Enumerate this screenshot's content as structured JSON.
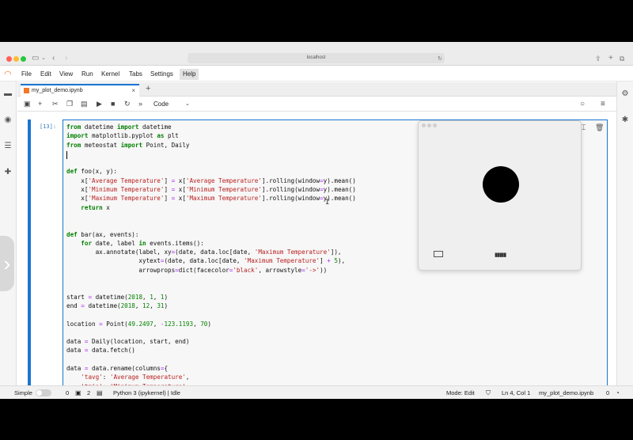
{
  "browser": {
    "url": "localhost"
  },
  "menu": {
    "items": [
      "File",
      "Edit",
      "View",
      "Run",
      "Kernel",
      "Tabs",
      "Settings",
      "Help"
    ]
  },
  "tab": {
    "title": "my_plot_demo.ipynb",
    "close": "×",
    "add": "+"
  },
  "toolbar": {
    "cell_type": "Code"
  },
  "cell": {
    "prompt": "[13]:"
  },
  "status": {
    "mode_label": "Simple",
    "count1": "0",
    "count2": "2",
    "kernel": "Python 3 (ipykernel) | Idle",
    "mode": "Mode: Edit",
    "position": "Ln 4, Col 1",
    "file": "my_plot_demo.ipynb",
    "count3": "0"
  },
  "colors": {
    "accent": "#1976d2",
    "jupyter_orange": "#f37726"
  },
  "icons": [
    "folder-icon",
    "running-icon",
    "toc-icon",
    "extension-icon",
    "property-inspector-icon",
    "debugger-icon"
  ]
}
